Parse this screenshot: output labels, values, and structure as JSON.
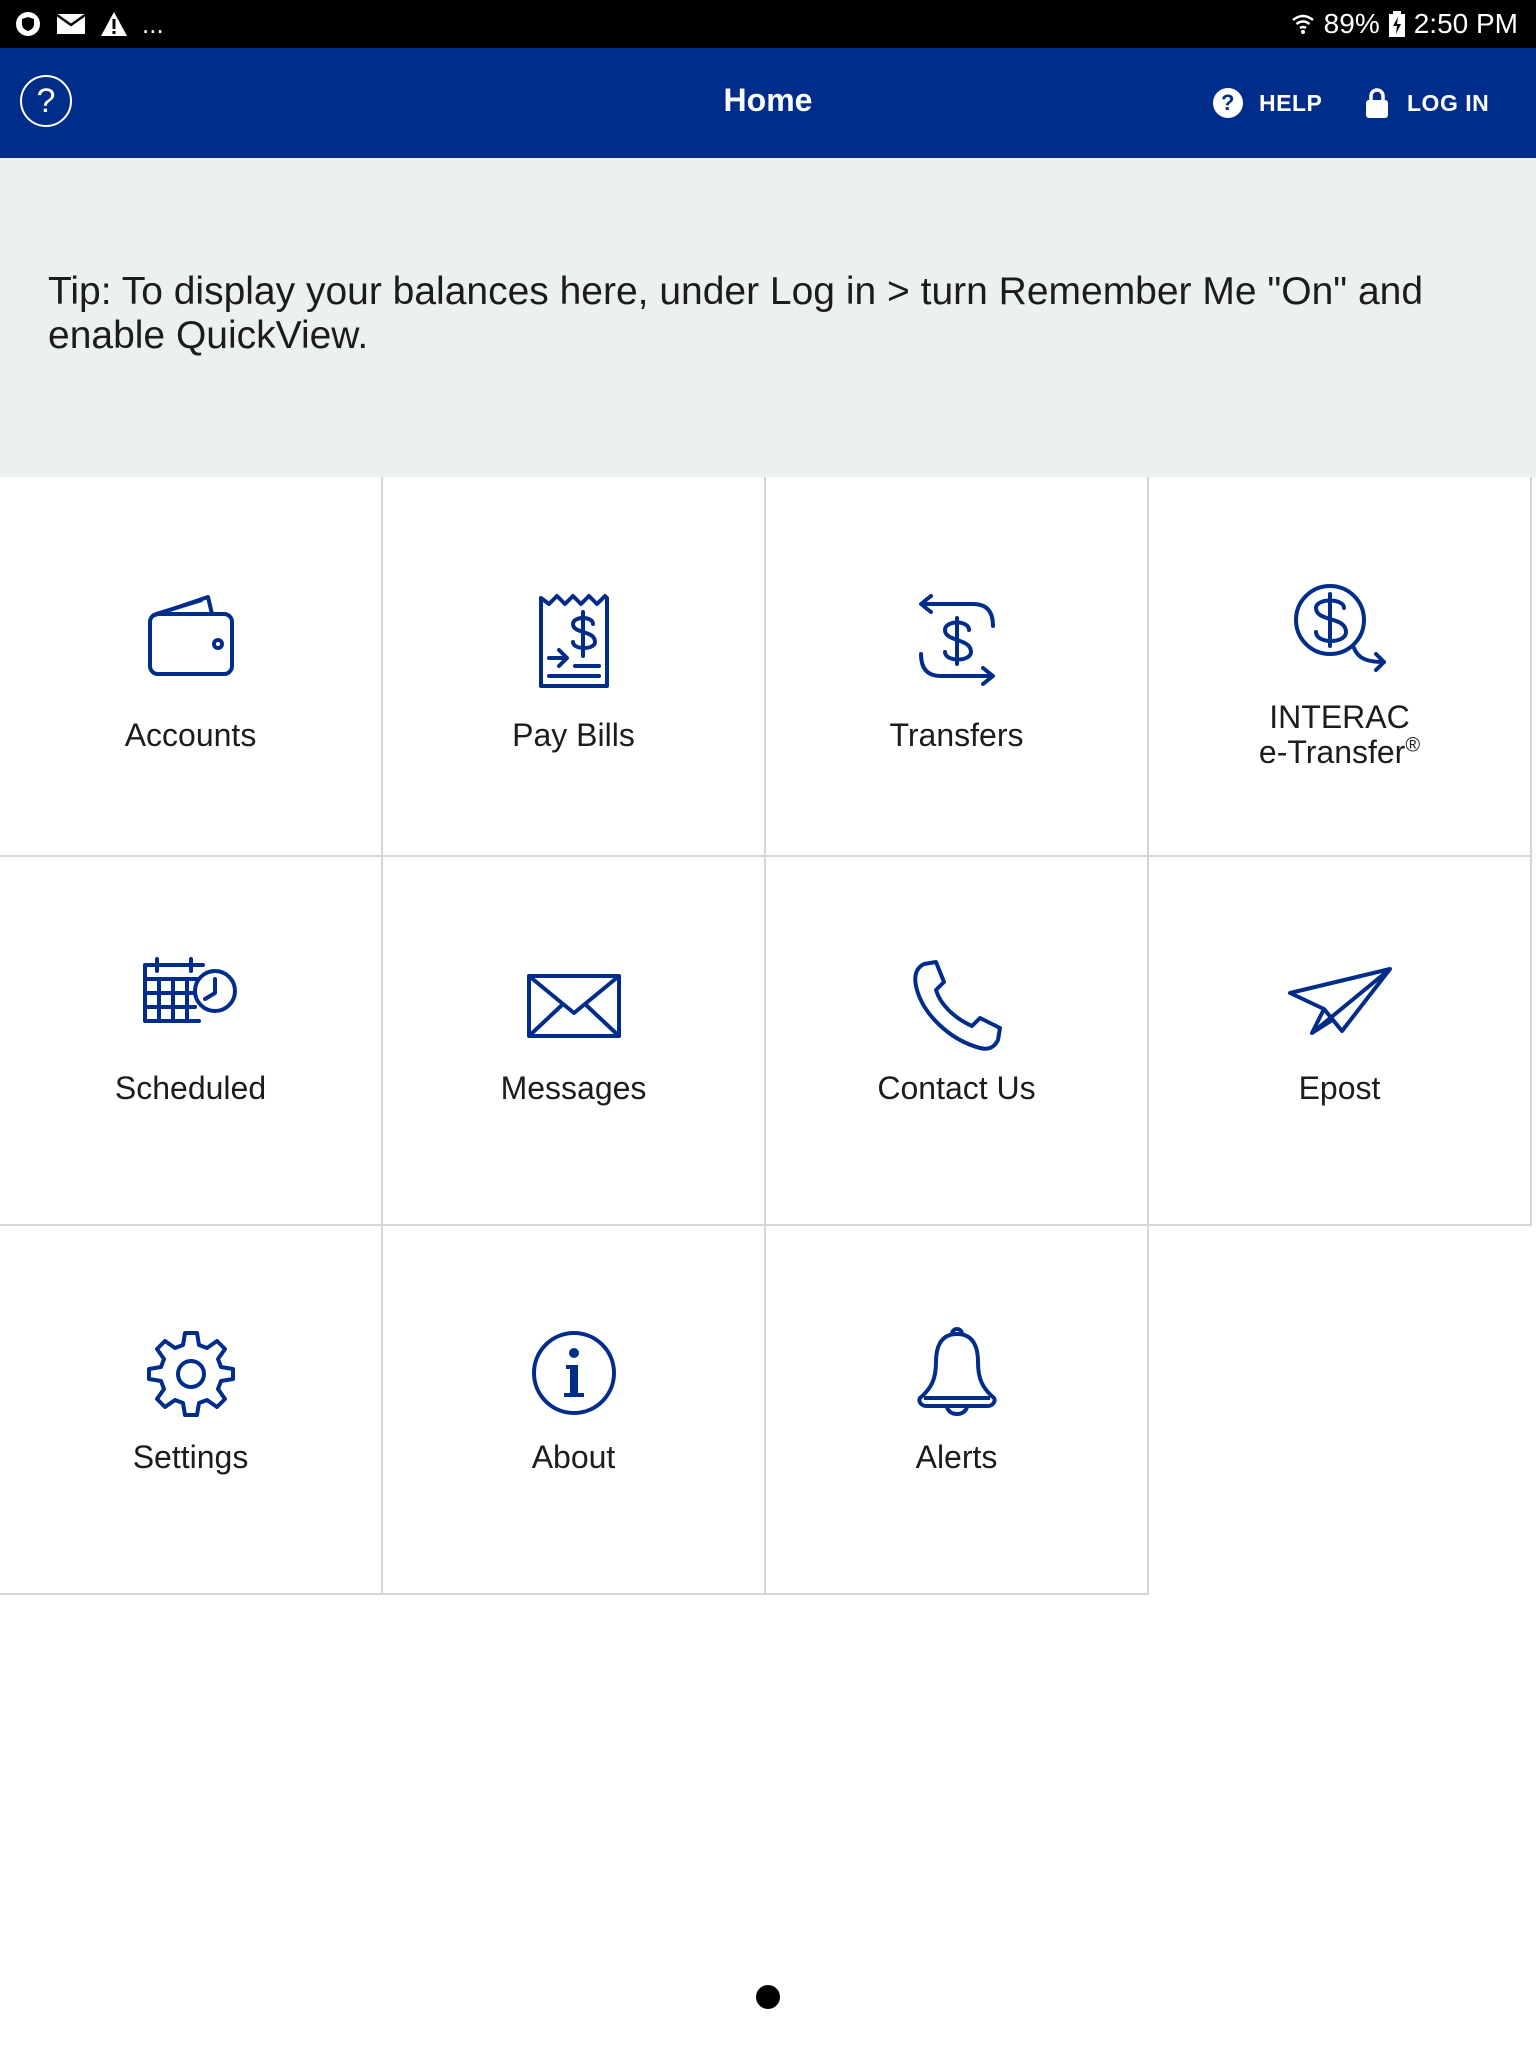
{
  "status_bar": {
    "more": "...",
    "battery": "89%",
    "time": "2:50 PM"
  },
  "header": {
    "title": "Home",
    "help_label": "HELP",
    "login_label": "LOG IN"
  },
  "tip": {
    "text": "Tip: To display your balances here, under Log in > turn Remember Me \"On\" and enable QuickView."
  },
  "tiles": [
    {
      "label": "Accounts",
      "icon": "wallet-icon"
    },
    {
      "label": "Pay Bills",
      "icon": "bill-receipt-icon"
    },
    {
      "label": "Transfers",
      "icon": "transfer-arrows-icon"
    },
    {
      "label_line1": "INTERAC",
      "label_line2": "e-Transfer",
      "label_sup": "®",
      "icon": "dollar-arrow-icon"
    },
    {
      "label": "Scheduled",
      "icon": "calendar-clock-icon"
    },
    {
      "label": "Messages",
      "icon": "envelope-icon"
    },
    {
      "label": "Contact Us",
      "icon": "phone-icon"
    },
    {
      "label": "Epost",
      "icon": "paper-plane-icon"
    },
    {
      "label": "Settings",
      "icon": "gear-icon"
    },
    {
      "label": "About",
      "icon": "info-icon"
    },
    {
      "label": "Alerts",
      "icon": "bell-icon"
    }
  ],
  "colors": {
    "brand_blue": "#002d8a",
    "banner_gray": "#edf0f1",
    "grid_line": "#d6d6d6"
  }
}
